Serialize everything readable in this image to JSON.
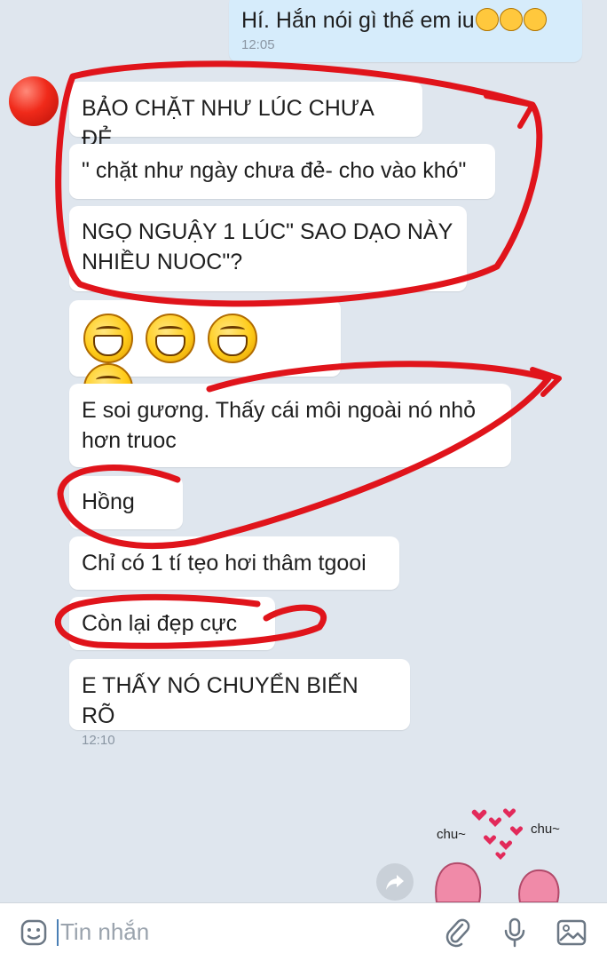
{
  "messages": {
    "outgoing": {
      "text": "Hí. Hắn nói gì thế em iu",
      "time": "12:05"
    },
    "m1": "BẢO CHẶT NHƯ LÚC CHƯA ĐẺ",
    "m2": "\" chặt như ngày chưa đẻ- cho vào khó\"",
    "m3_line1": "NGỌ NGUẬY 1 LÚC\" SAO DẠO NÀY",
    "m3_line2": "NHIỀU NUOC\"?",
    "m5_line1": "E soi gương. Thấy cái môi ngoài nó nhỏ",
    "m5_line2": "hơn truoc",
    "m6": "Hồng",
    "m7": "Chỉ có 1 tí tẹo hơi thâm tgooi",
    "m8": "Còn lại đẹp cực",
    "m9": {
      "text": "E THẤY NÓ CHUYỂN BIẾN RÕ",
      "time": "12:10"
    }
  },
  "sticker": {
    "left_text": "chu~",
    "right_text": "chu~"
  },
  "input": {
    "placeholder": "Tin nhắn"
  },
  "icons": [
    "share-icon",
    "emoji-icon",
    "attach-icon",
    "mic-icon",
    "image-icon"
  ],
  "colors": {
    "annotation": "#e0141b",
    "outgoing_bubble": "#d6ecfb",
    "incoming_bubble": "#ffffff",
    "background": "#dfe6ee"
  }
}
